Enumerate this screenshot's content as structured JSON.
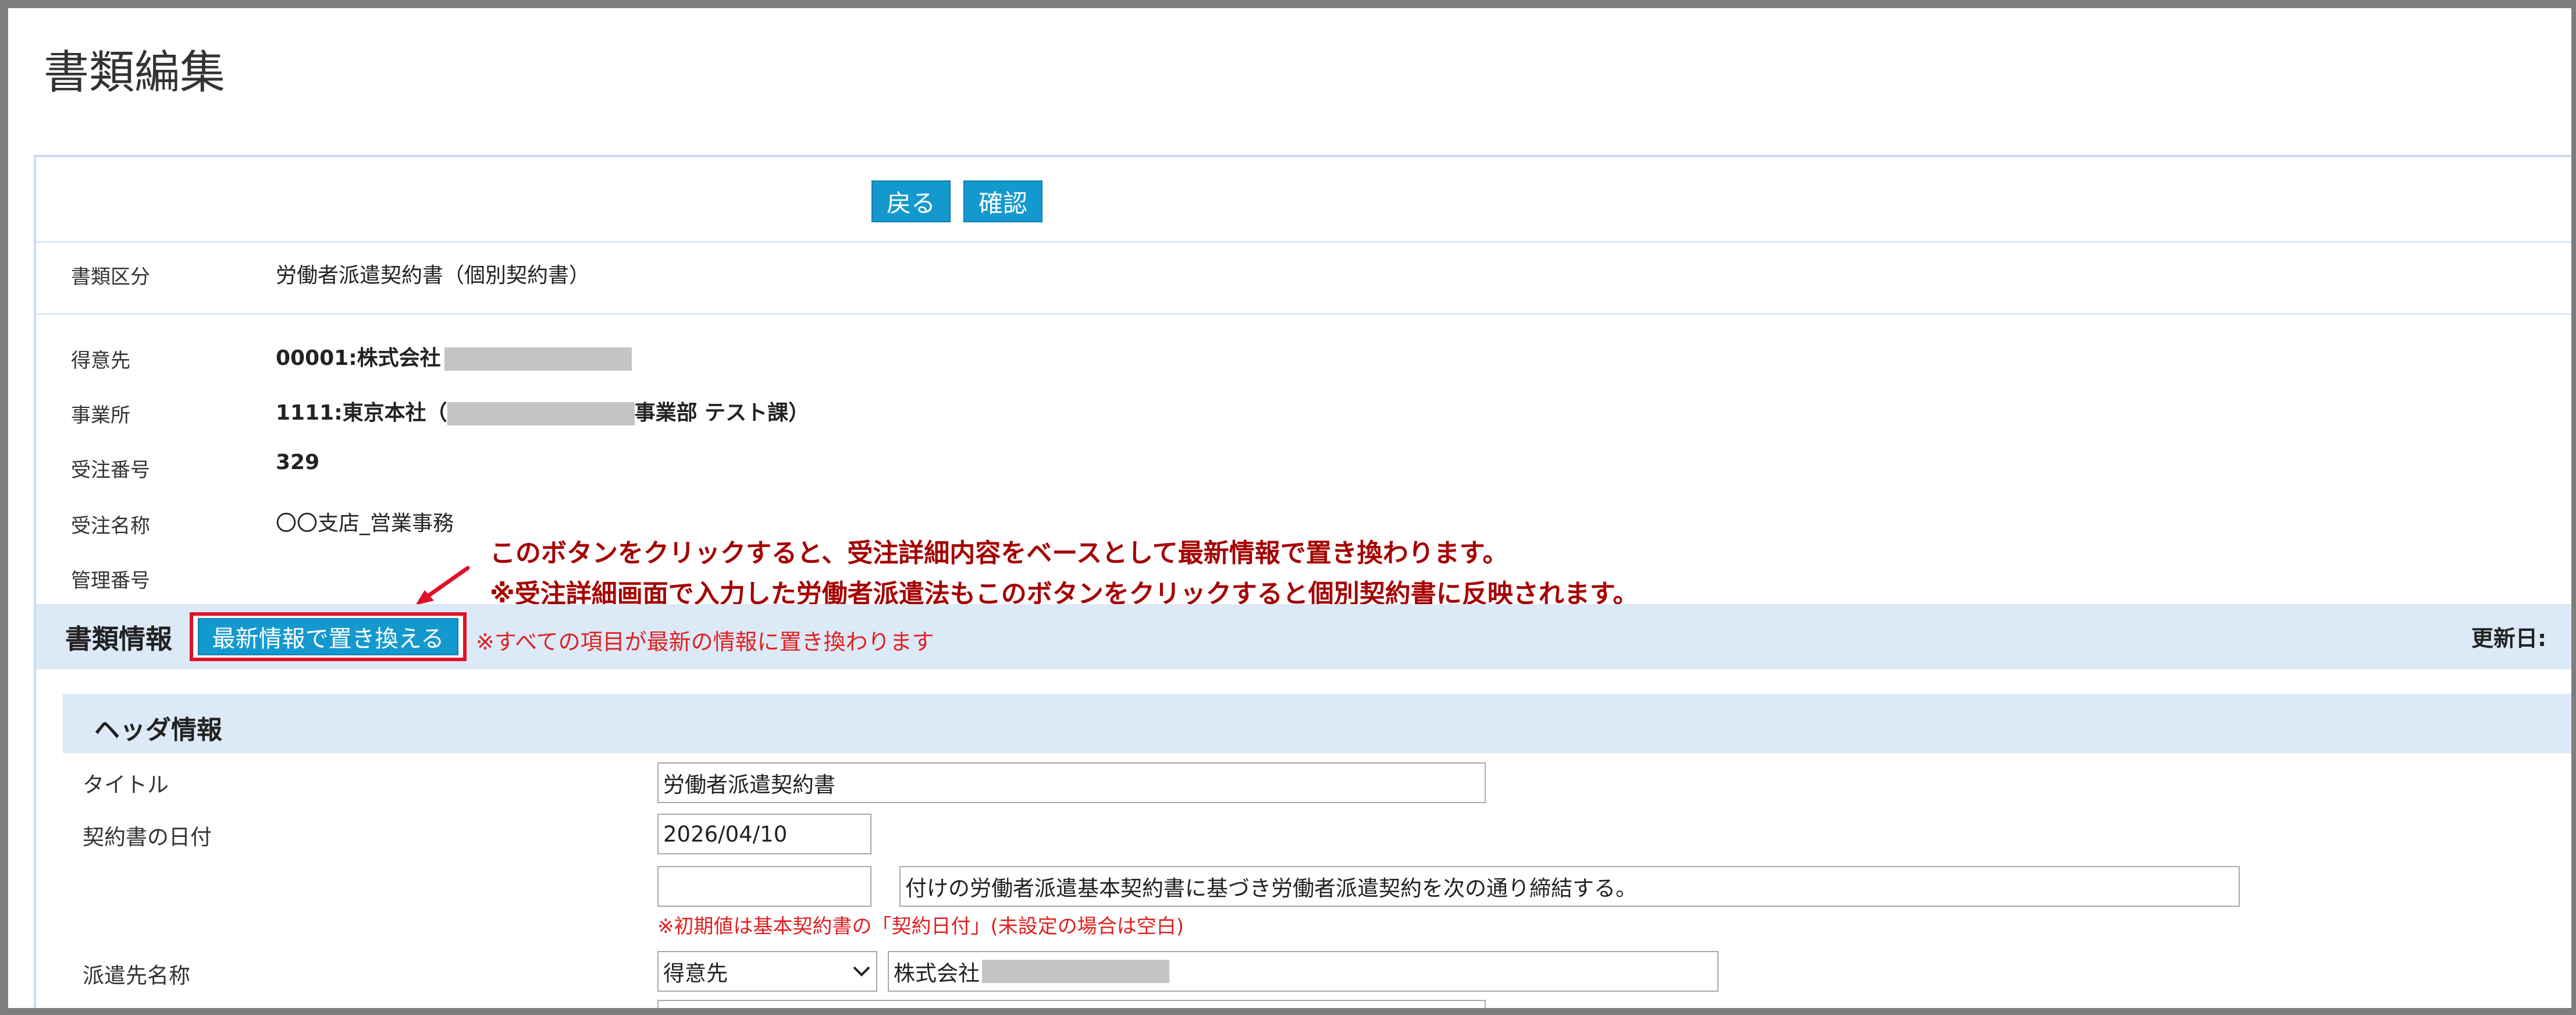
{
  "page": {
    "title": "書類編集"
  },
  "toolbar": {
    "back_label": "戻る",
    "confirm_label": "確認"
  },
  "summary": {
    "doc_type_label": "書類区分",
    "doc_type_value": "労働者派遣契約書（個別契約書）",
    "client_label": "得意先",
    "client_value": "00001:株式会社",
    "office_label": "事業所",
    "office_value_prefix": "1111:東京本社（",
    "office_value_suffix": "事業部 テスト課）",
    "order_no_label": "受注番号",
    "order_no_value": "329",
    "order_name_label": "受注名称",
    "order_name_value": "〇〇支店_営業事務",
    "mgmt_no_label": "管理番号",
    "mgmt_no_value": ""
  },
  "annotation": {
    "line1": "このボタンをクリックすると、受注詳細内容をベースとして最新情報で置き換わります。",
    "line2": "※受注詳細画面で入力した労働者派遣法もこのボタンをクリックすると個別契約書に反映されます。"
  },
  "doc_info": {
    "heading": "書類情報",
    "replace_button_label": "最新情報で置き換える",
    "replace_note": "※すべての項目が最新の情報に置き換わります",
    "updated_label": "更新日:"
  },
  "header_info": {
    "heading": "ヘッダ情報",
    "title_label": "タイトル",
    "title_value": "労働者派遣契約書",
    "date_label": "契約書の日付",
    "date_value": "2026/04/10",
    "base_date_value": "",
    "sentence_value": "付けの労働者派遣基本契約書に基づき労働者派遣契約を次の通り締結する。",
    "date_note": "※初期値は基本契約書の「契約日付」(未設定の場合は空白)",
    "dest_label": "派遣先名称",
    "dest_select_value": "得意先",
    "dest_name_value": "株式会社"
  },
  "colors": {
    "accent": "#1499cf",
    "section_bg": "#dce9f7",
    "annotation_text": "#a50000",
    "highlight_border": "#e0102a",
    "note_red": "#e02020"
  }
}
